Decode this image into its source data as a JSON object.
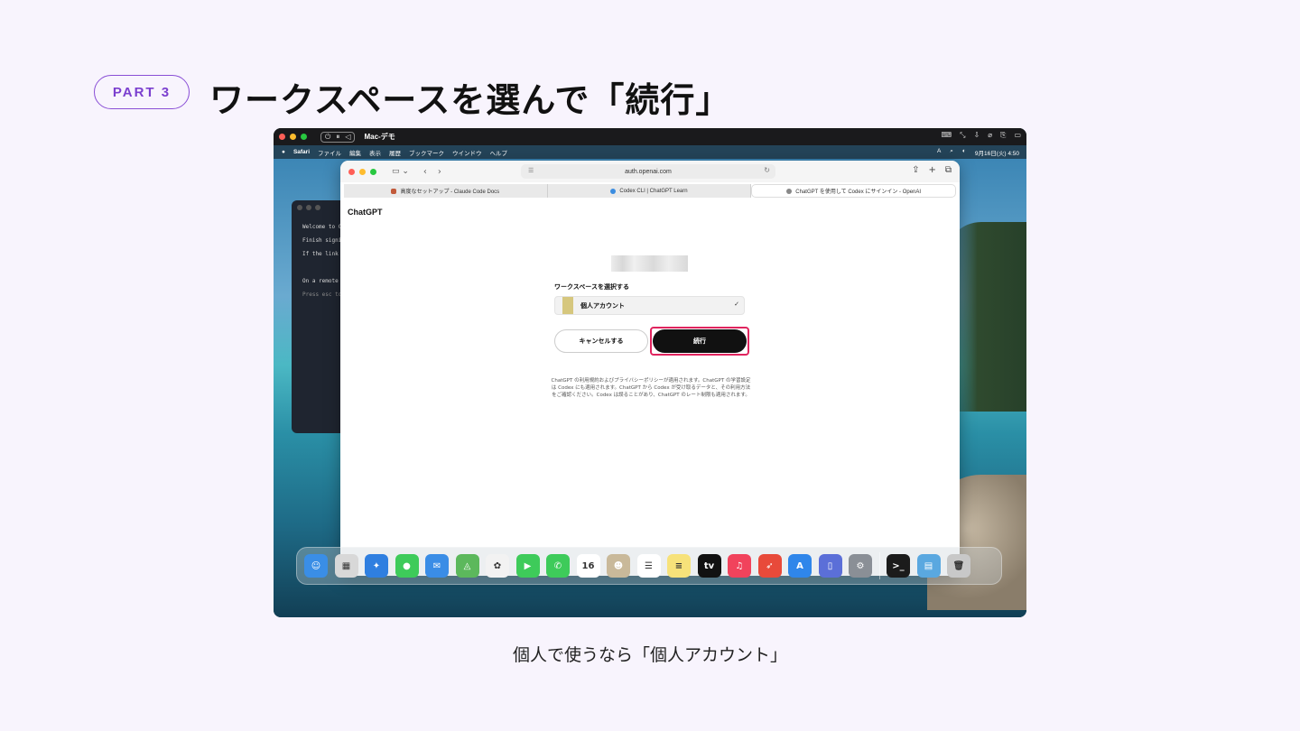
{
  "slide": {
    "part_badge": "PART 3",
    "title": "ワークスペースを選んで「続行」",
    "caption": "個人で使うなら「個人アカウント」"
  },
  "vm_window": {
    "title": "Mac-デモ",
    "controls": [
      "⏻",
      "⏸",
      "◁"
    ]
  },
  "menubar": {
    "apple": "",
    "items": [
      "Safari",
      "ファイル",
      "編集",
      "表示",
      "履歴",
      "ブックマーク",
      "ウインドウ",
      "ヘルプ"
    ],
    "input_indicator": "A",
    "datetime": "9月16日(火) 4:50"
  },
  "terminal": {
    "lines": [
      "Welcome to C",
      "Finish signi",
      "If the link",
      "",
      "On a remote",
      "Press esc to"
    ]
  },
  "safari": {
    "url": "auth.openai.com",
    "tabs": [
      {
        "label": "高度なセットアップ - Claude Code Docs",
        "favicon_color": "#c25a3a"
      },
      {
        "label": "Codex CLI | ChatGPT Learn",
        "favicon_color": "#3b8de0"
      },
      {
        "label": "ChatGPT を使用して Codex にサインイン - OpenAI",
        "favicon_color": "#888888"
      }
    ]
  },
  "page": {
    "brand": "ChatGPT",
    "workspace_label": "ワークスペースを選択する",
    "workspace_option": "個人アカウント",
    "cancel_label": "キャンセルする",
    "continue_label": "続行",
    "terms_line1": "ChatGPT の利用規約およびプライバシーポリシーが適用されます。ChatGPT の学習設定",
    "terms_line2": "は Codex にも適用されます。ChatGPT から Codex が受け取るデータと、その利用方法",
    "terms_line3": "をご確認ください。Codex は誤ることがあり、ChatGPT のレート制限も適用されます。"
  },
  "dock": {
    "apps": [
      {
        "name": "finder",
        "color": "#3a8ee6",
        "glyph": "☺"
      },
      {
        "name": "launchpad",
        "color": "#d8d8d8",
        "glyph": "▦"
      },
      {
        "name": "safari",
        "color": "#2f7fe0",
        "glyph": "✦"
      },
      {
        "name": "messages",
        "color": "#3ecb5a",
        "glyph": "●"
      },
      {
        "name": "mail",
        "color": "#3a8de6",
        "glyph": "✉"
      },
      {
        "name": "maps",
        "color": "#5cb85c",
        "glyph": "◬"
      },
      {
        "name": "photos",
        "color": "#f2f2f2",
        "glyph": "✿"
      },
      {
        "name": "facetime",
        "color": "#3ecb5a",
        "glyph": "▶"
      },
      {
        "name": "phone",
        "color": "#3ecb5a",
        "glyph": "✆"
      },
      {
        "name": "calendar",
        "color": "#ffffff",
        "glyph": "16"
      },
      {
        "name": "contacts",
        "color": "#c9b99a",
        "glyph": "☻"
      },
      {
        "name": "reminders",
        "color": "#ffffff",
        "glyph": "☰"
      },
      {
        "name": "notes",
        "color": "#f7e27a",
        "glyph": "≡"
      },
      {
        "name": "tv",
        "color": "#111111",
        "glyph": "tv"
      },
      {
        "name": "music",
        "color": "#f1435c",
        "glyph": "♫"
      },
      {
        "name": "launcher",
        "color": "#e84a3a",
        "glyph": "➶"
      },
      {
        "name": "app-store",
        "color": "#2f86ea",
        "glyph": "A"
      },
      {
        "name": "iphone-mirroring",
        "color": "#5b6fd8",
        "glyph": "▯"
      },
      {
        "name": "settings",
        "color": "#8a8f96",
        "glyph": "⚙"
      }
    ],
    "extras": [
      {
        "name": "terminal",
        "color": "#1b1b1b",
        "glyph": ">_"
      },
      {
        "name": "downloads",
        "color": "#5aa8e0",
        "glyph": "▤"
      },
      {
        "name": "trash",
        "color": "#c8c8c8",
        "glyph": "🗑"
      }
    ]
  }
}
